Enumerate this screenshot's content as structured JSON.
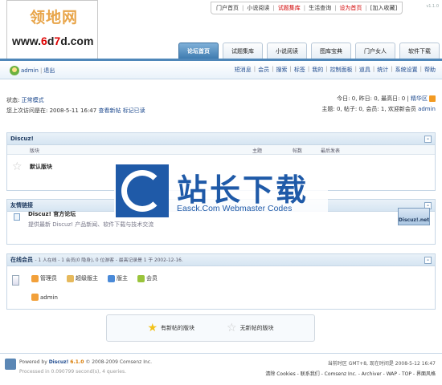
{
  "header": {
    "brand": "领地网",
    "url_prefix": "www.",
    "url_mid1": "6",
    "url_mid2": "d",
    "url_mid3": "7",
    "url_suffix": "d.com",
    "top_links": [
      "门户首页",
      "小说阅读",
      "试题集库",
      "生活查询",
      "设为首页",
      "[加入收藏]"
    ],
    "version_tag": "v1.1.0"
  },
  "tabs": [
    "论坛首页",
    "试题集库",
    "小说阅读",
    "图库宝典",
    "门户女人",
    "软件下载"
  ],
  "userbar": {
    "username": "admin",
    "logout": "退出",
    "links": [
      "短消息",
      "会员",
      "搜索",
      "标签",
      "我的",
      "控制面板",
      "道具",
      "统计",
      "系统设置",
      "帮助"
    ]
  },
  "status": {
    "state_label": "状态:",
    "state_value": "正常模式",
    "last_visit": "您上次访问是在: 2008-5-11 16:47",
    "view_new": "查看新帖",
    "mark_read": "标记已读",
    "today_stats": "今日: 0, 昨日: 0, 最高日: 0",
    "digest": "精华区",
    "topic_stats": "主题: 0, 帖子: 0, 会员: 1, 欢迎新会员",
    "new_member": "admin"
  },
  "forum": {
    "panel_title": "Discuz!",
    "cols": {
      "forum": "版块",
      "topics": "主题",
      "posts": "帖数",
      "last": "最后发表"
    },
    "rows": [
      {
        "name": "默认版块"
      }
    ]
  },
  "friendlinks": {
    "panel_title": "友情链接",
    "title": "Discuz! 官方论坛",
    "desc": "提供最新 Discuz! 产品新闻、软件下载与技术交流",
    "badge": "Discuz!.net"
  },
  "online": {
    "title": "在线会员",
    "summary": "- 1 人在线 - 1 会员(0 隐身), 0 位游客 - 最高记录是 1 于 2002-12-16.",
    "legend": [
      {
        "label": "管理员",
        "color": "#f2a03a"
      },
      {
        "label": "超级版主",
        "color": "#e6b95c"
      },
      {
        "label": "版主",
        "color": "#4a8ad8"
      },
      {
        "label": "会员",
        "color": "#9ac43b"
      }
    ],
    "user": "admin"
  },
  "newlegend": {
    "has_new": "有新帖的版块",
    "no_new": "无新帖的版块"
  },
  "footer": {
    "powered": "Powered by",
    "product": "Discuz!",
    "version": "6.1.0",
    "copyright": "© 2008-2009 Comsenz Inc.",
    "processed": "Processed in 0.090799 second(s), 4 queries.",
    "time": "当前时区 GMT+8, 现在时间是 2008-5-12 16:47",
    "links": "清除 Cookies - 联系我们 - Comsenz Inc. - Archiver - WAP - TOP - 界面风格"
  },
  "watermark": {
    "title": "站长下载",
    "subtitle": "Easck.Com Webmaster Codes"
  }
}
